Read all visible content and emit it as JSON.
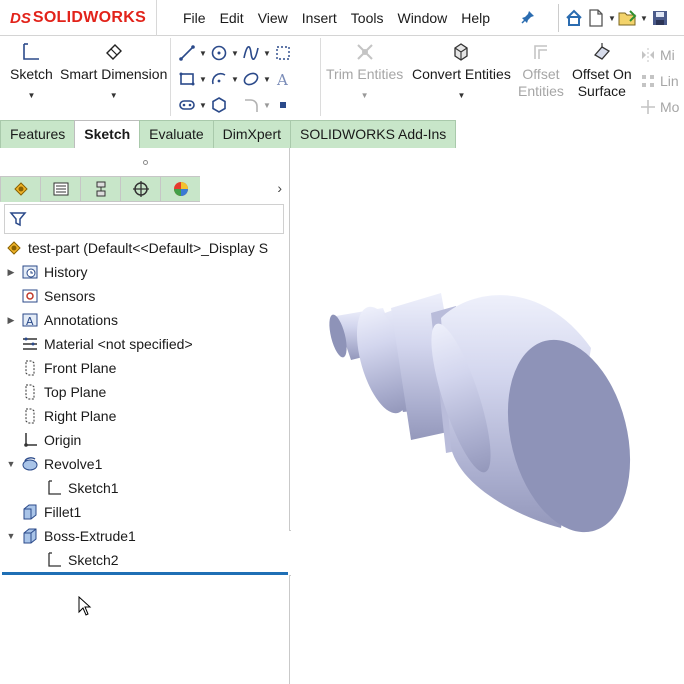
{
  "app": {
    "logo_ds": "DS",
    "logo_word": "SOLIDWORKS"
  },
  "menu": [
    "File",
    "Edit",
    "View",
    "Insert",
    "Tools",
    "Window",
    "Help"
  ],
  "quick_access": [
    "home-icon",
    "new-document-icon",
    "open-document-icon",
    "save-icon"
  ],
  "command_manager": {
    "sketch": "Sketch",
    "smart_dimension": "Smart Dimension",
    "trim_entities": "Trim Entities",
    "convert_entities": "Convert Entities",
    "offset_entities_1": "Offset",
    "offset_entities_2": "Entities",
    "offset_on_surface_1": "Offset On",
    "offset_on_surface_2": "Surface",
    "mirror": "Mi",
    "linear": "Lin",
    "move": "Mo"
  },
  "tabs": [
    "Features",
    "Sketch",
    "Evaluate",
    "DimXpert",
    "SOLIDWORKS Add-Ins"
  ],
  "active_tab": "Sketch",
  "tree": {
    "root": "test-part  (Default<<Default>_Display S",
    "items": [
      {
        "label": "History",
        "icon": "history-icon",
        "expandable": true
      },
      {
        "label": "Sensors",
        "icon": "sensors-icon",
        "expandable": false
      },
      {
        "label": "Annotations",
        "icon": "annotations-icon",
        "expandable": true
      },
      {
        "label": "Material <not specified>",
        "icon": "material-icon",
        "expandable": false
      },
      {
        "label": "Front Plane",
        "icon": "plane-icon",
        "expandable": false
      },
      {
        "label": "Top Plane",
        "icon": "plane-icon",
        "expandable": false
      },
      {
        "label": "Right Plane",
        "icon": "plane-icon",
        "expandable": false
      },
      {
        "label": "Origin",
        "icon": "origin-icon",
        "expandable": false
      },
      {
        "label": "Revolve1",
        "icon": "revolve-icon",
        "expandable": true,
        "expanded": true
      },
      {
        "label": "Sketch1",
        "icon": "sketch-icon",
        "expandable": false
      },
      {
        "label": "Fillet1",
        "icon": "fillet-icon",
        "expandable": false
      },
      {
        "label": "Boss-Extrude1",
        "icon": "extrude-icon",
        "expandable": true,
        "expanded": true
      },
      {
        "label": "Sketch2",
        "icon": "sketch-icon",
        "expandable": false
      }
    ]
  },
  "colors": {
    "brand_red": "#e2231a",
    "tab_green": "#c8e6c9",
    "rollback_blue": "#1f6fb5",
    "part_face": "#8e93b8",
    "part_body": "#c9cce6"
  }
}
